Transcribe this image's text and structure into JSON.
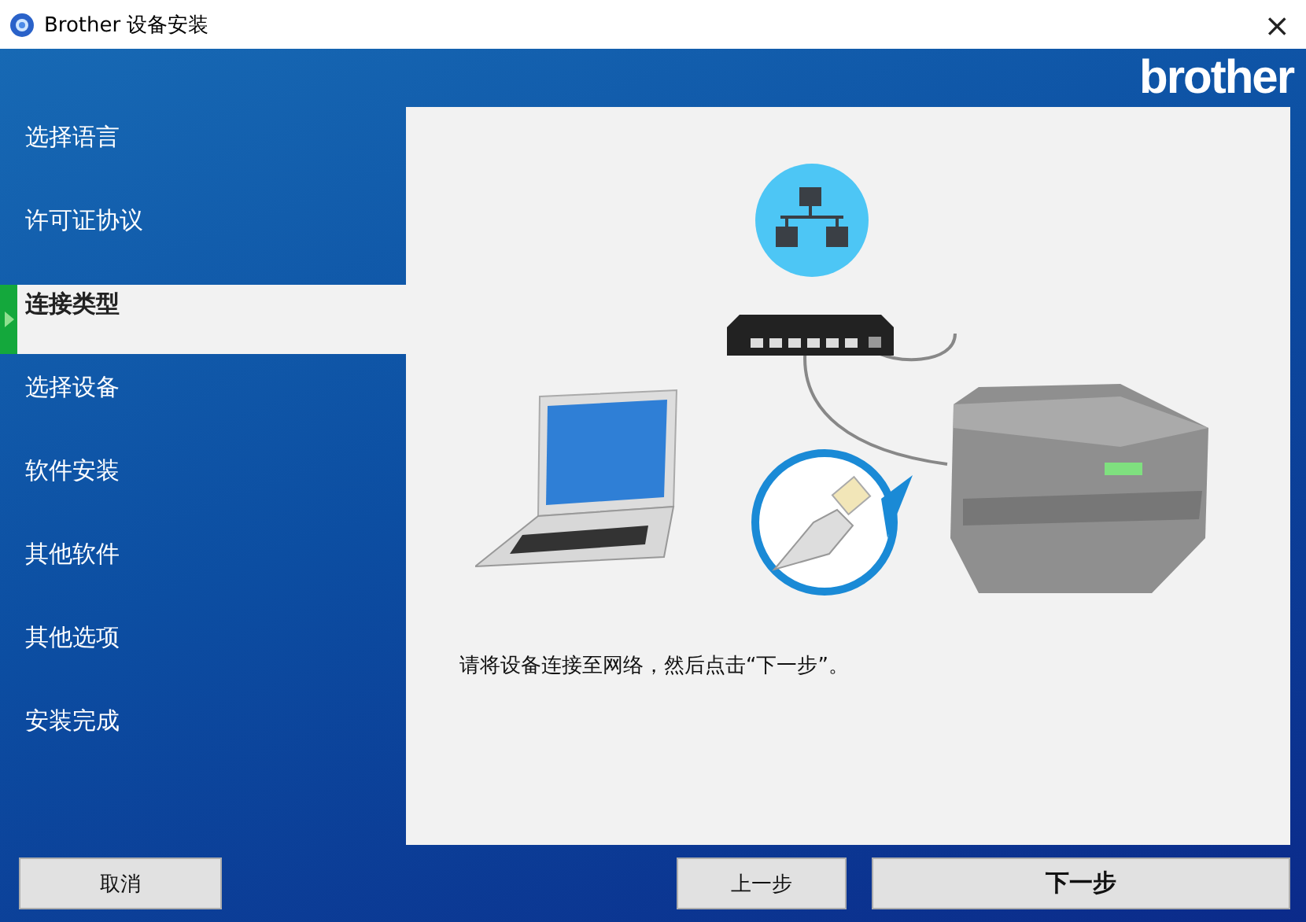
{
  "window": {
    "title": "Brother 设备安装",
    "close": "×"
  },
  "logo": "brother",
  "sidebar": {
    "items": [
      {
        "label": "选择语言",
        "selected": false
      },
      {
        "label": "许可证协议",
        "selected": false
      },
      {
        "label": "连接类型",
        "selected": true
      },
      {
        "label": "选择设备",
        "selected": false
      },
      {
        "label": "软件安装",
        "selected": false
      },
      {
        "label": "其他软件",
        "selected": false
      },
      {
        "label": "其他选项",
        "selected": false
      },
      {
        "label": "安装完成",
        "selected": false
      }
    ]
  },
  "content": {
    "instruction": "请将设备连接至网络，然后点击“下一步”。"
  },
  "buttons": [
    {
      "label": "取消",
      "kind": "cancel",
      "default": false
    },
    {
      "label": "上一步",
      "kind": "back",
      "default": false
    },
    {
      "label": "下一步",
      "kind": "next",
      "default": true
    }
  ]
}
